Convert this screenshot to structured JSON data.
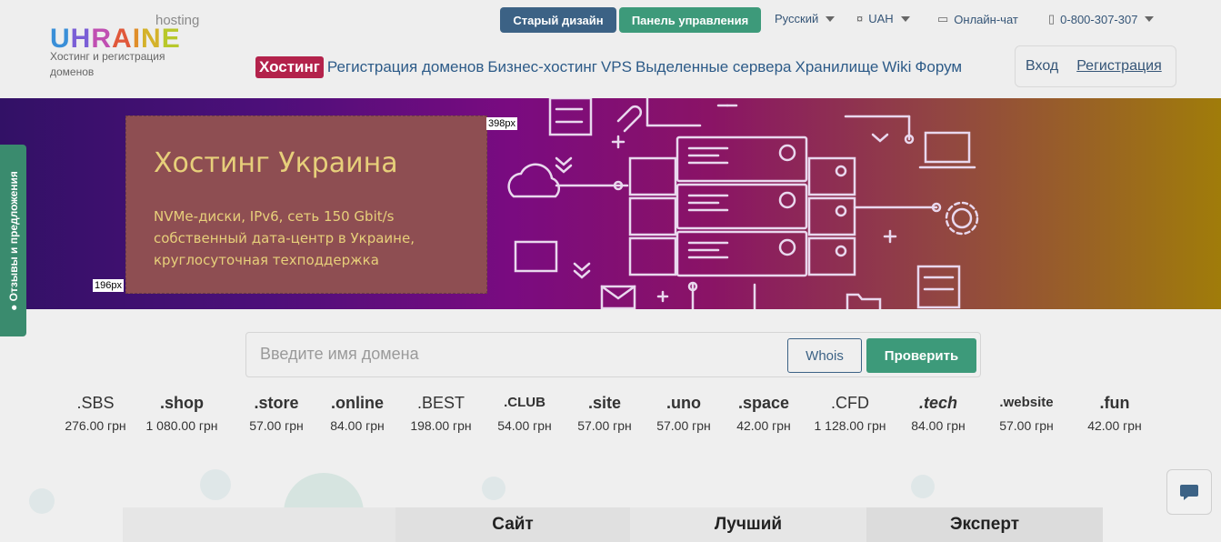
{
  "logo": {
    "top": "hosting",
    "word": "UHRAINE",
    "subtitle": "Хостинг и регистрация доменов"
  },
  "topbar": {
    "old_design": "Старый дизайн",
    "control_panel": "Панель управления",
    "language": "Русский",
    "currency": "UAH",
    "chat": "Онлайн-чат",
    "phone": "0-800-307-307"
  },
  "nav": {
    "items": [
      "Хостинг",
      "Регистрация доменов",
      "Бизнес-хостинг",
      "VPS",
      "Выделенные сервера",
      "Хранилище",
      "Wiki",
      "Форум"
    ]
  },
  "auth": {
    "login": "Вход",
    "register": "Регистрация"
  },
  "hero": {
    "title": "Хостинг Украина",
    "line1": "NVMe-диски, IPv6, сеть 150 Gbit/s",
    "line2": "собственный дата-центр в Украине,",
    "line3": "круглосуточная техподдержка",
    "width_label": "398px",
    "height_label": "196px"
  },
  "sidetab": {
    "label": "Отзывы и предложения"
  },
  "search": {
    "placeholder": "Введите имя домена",
    "whois": "Whois",
    "check": "Проверить"
  },
  "tlds": [
    {
      "name": ".SBS",
      "price": "276.00 грн"
    },
    {
      "name": ".shop",
      "price": "1 080.00 грн"
    },
    {
      "name": ".store",
      "price": "57.00 грн"
    },
    {
      "name": ".online",
      "price": "84.00 грн"
    },
    {
      "name": ".BEST",
      "price": "198.00 грн"
    },
    {
      "name": ".CLUB",
      "price": "54.00 грн"
    },
    {
      "name": ".site",
      "price": "57.00 грн"
    },
    {
      "name": ".uno",
      "price": "57.00 грн"
    },
    {
      "name": ".space",
      "price": "42.00 грн"
    },
    {
      "name": ".CFD",
      "price": "1 128.00 грн"
    },
    {
      "name": ".tech",
      "price": "84.00 грн"
    },
    {
      "name": ".website",
      "price": "57.00 грн"
    },
    {
      "name": ".fun",
      "price": "42.00 грн"
    }
  ],
  "plans": [
    "Сайт",
    "Лучший",
    "Эксперт"
  ],
  "icons": {
    "language": "chevron-down-icon",
    "currency": "currency-icon",
    "chat": "chat-icon",
    "phone": "phone-icon",
    "feedback": "lightbulb-icon",
    "chat_widget": "chat-bubble-icon"
  },
  "colors": {
    "old_design": "#3c6285",
    "panel": "#3d9a7a",
    "active_nav": "#b3224b",
    "hero_text": "#e7cf7a",
    "check": "#3d9a7a"
  }
}
